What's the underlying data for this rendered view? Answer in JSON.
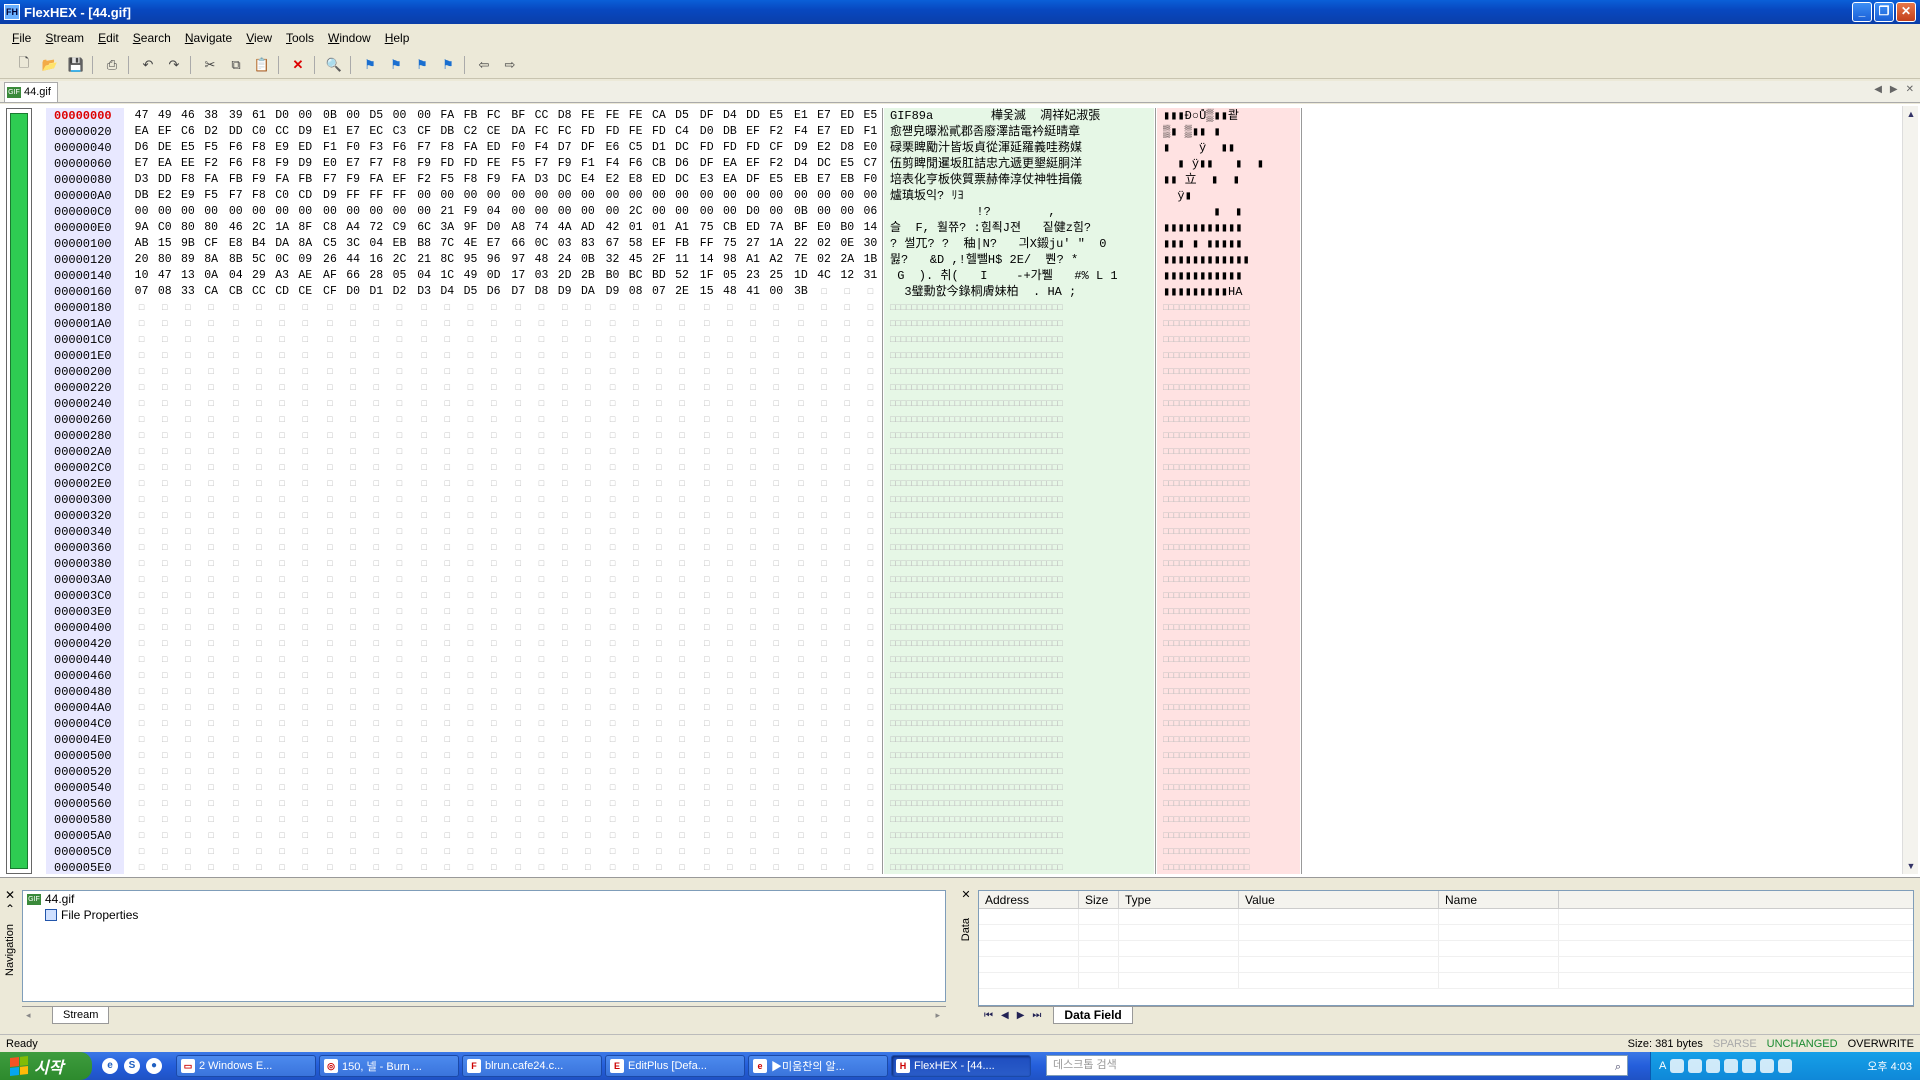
{
  "window": {
    "title": "FlexHEX - [44.gif]",
    "min": "_",
    "restore": "❐",
    "close": "✕"
  },
  "menu": [
    "File",
    "Stream",
    "Edit",
    "Search",
    "Navigate",
    "View",
    "Tools",
    "Window",
    "Help"
  ],
  "toolbar_icons": [
    "new-file-icon",
    "open-folder-icon",
    "save-icon",
    "print-icon",
    "undo-icon",
    "redo-icon",
    "cut-icon",
    "copy-icon",
    "paste-icon",
    "delete-icon",
    "find-icon",
    "bookmark-icon",
    "bookmark-prev-icon",
    "bookmark-next-icon",
    "bookmark-clear-icon",
    "back-icon",
    "forward-icon"
  ],
  "doc_tab": {
    "label": "44.gif",
    "close": "✕"
  },
  "offsets": [
    "00000000",
    "00000020",
    "00000040",
    "00000060",
    "00000080",
    "000000A0",
    "000000C0",
    "000000E0",
    "00000100",
    "00000120",
    "00000140",
    "00000160",
    "00000180",
    "000001A0",
    "000001C0",
    "000001E0",
    "00000200",
    "00000220",
    "00000240",
    "00000260",
    "00000280",
    "000002A0",
    "000002C0",
    "000002E0",
    "00000300",
    "00000320",
    "00000340",
    "00000360",
    "00000380",
    "000003A0",
    "000003C0",
    "000003E0",
    "00000400",
    "00000420",
    "00000440",
    "00000460",
    "00000480",
    "000004A0",
    "000004C0",
    "000004E0",
    "00000500",
    "00000520",
    "00000540",
    "00000560",
    "00000580",
    "000005A0",
    "000005C0",
    "000005E0"
  ],
  "hex_rows": [
    [
      "47",
      "49",
      "46",
      "38",
      "39",
      "61",
      "D0",
      "00",
      "0B",
      "00",
      "D5",
      "00",
      "00",
      "FA",
      "FB",
      "FC",
      "BF",
      "CC",
      "D8",
      "FE",
      "FE",
      "FE",
      "CA",
      "D5",
      "DF",
      "D4",
      "DD",
      "E5",
      "E1",
      "E7",
      "ED",
      "E5"
    ],
    [
      "EA",
      "EF",
      "C6",
      "D2",
      "DD",
      "C0",
      "CC",
      "D9",
      "E1",
      "E7",
      "EC",
      "C3",
      "CF",
      "DB",
      "C2",
      "CE",
      "DA",
      "FC",
      "FC",
      "FD",
      "FD",
      "FE",
      "FD",
      "C4",
      "D0",
      "DB",
      "EF",
      "F2",
      "F4",
      "E7",
      "ED",
      "F1"
    ],
    [
      "D6",
      "DE",
      "E5",
      "F5",
      "F6",
      "F8",
      "E9",
      "ED",
      "F1",
      "F0",
      "F3",
      "F6",
      "F7",
      "F8",
      "FA",
      "ED",
      "F0",
      "F4",
      "D7",
      "DF",
      "E6",
      "C5",
      "D1",
      "DC",
      "FD",
      "FD",
      "FD",
      "CF",
      "D9",
      "E2",
      "D8",
      "E0"
    ],
    [
      "E7",
      "EA",
      "EE",
      "F2",
      "F6",
      "F8",
      "F9",
      "D9",
      "E0",
      "E7",
      "F7",
      "F8",
      "F9",
      "FD",
      "FD",
      "FE",
      "F5",
      "F7",
      "F9",
      "F1",
      "F4",
      "F6",
      "CB",
      "D6",
      "DF",
      "EA",
      "EF",
      "F2",
      "D4",
      "DC",
      "E5",
      "C7"
    ],
    [
      "D3",
      "DD",
      "F8",
      "FA",
      "FB",
      "F9",
      "FA",
      "FB",
      "F7",
      "F9",
      "FA",
      "EF",
      "F2",
      "F5",
      "F8",
      "F9",
      "FA",
      "D3",
      "DC",
      "E4",
      "E2",
      "E8",
      "ED",
      "DC",
      "E3",
      "EA",
      "DF",
      "E5",
      "EB",
      "E7",
      "EB",
      "F0"
    ],
    [
      "DB",
      "E2",
      "E9",
      "F5",
      "F7",
      "F8",
      "C0",
      "CD",
      "D9",
      "FF",
      "FF",
      "FF",
      "00",
      "00",
      "00",
      "00",
      "00",
      "00",
      "00",
      "00",
      "00",
      "00",
      "00",
      "00",
      "00",
      "00",
      "00",
      "00",
      "00",
      "00",
      "00",
      "00"
    ],
    [
      "00",
      "00",
      "00",
      "00",
      "00",
      "00",
      "00",
      "00",
      "00",
      "00",
      "00",
      "00",
      "00",
      "21",
      "F9",
      "04",
      "00",
      "00",
      "00",
      "00",
      "00",
      "2C",
      "00",
      "00",
      "00",
      "00",
      "D0",
      "00",
      "0B",
      "00",
      "00",
      "06"
    ],
    [
      "9A",
      "C0",
      "80",
      "80",
      "46",
      "2C",
      "1A",
      "8F",
      "C8",
      "A4",
      "72",
      "C9",
      "6C",
      "3A",
      "9F",
      "D0",
      "A8",
      "74",
      "4A",
      "AD",
      "42",
      "01",
      "01",
      "A1",
      "75",
      "CB",
      "ED",
      "7A",
      "BF",
      "E0",
      "B0",
      "14"
    ],
    [
      "AB",
      "15",
      "9B",
      "CF",
      "E8",
      "B4",
      "DA",
      "8A",
      "C5",
      "3C",
      "04",
      "EB",
      "B8",
      "7C",
      "4E",
      "E7",
      "66",
      "0C",
      "03",
      "83",
      "67",
      "58",
      "EF",
      "FB",
      "FF",
      "75",
      "27",
      "1A",
      "22",
      "02",
      "0E",
      "30"
    ],
    [
      "20",
      "80",
      "89",
      "8A",
      "8B",
      "5C",
      "0C",
      "09",
      "26",
      "44",
      "16",
      "2C",
      "21",
      "8C",
      "95",
      "96",
      "97",
      "48",
      "24",
      "0B",
      "32",
      "45",
      "2F",
      "11",
      "14",
      "98",
      "A1",
      "A2",
      "7E",
      "02",
      "2A",
      "1B"
    ],
    [
      "10",
      "47",
      "13",
      "0A",
      "04",
      "29",
      "A3",
      "AE",
      "AF",
      "66",
      "28",
      "05",
      "04",
      "1C",
      "49",
      "0D",
      "17",
      "03",
      "2D",
      "2B",
      "B0",
      "BC",
      "BD",
      "52",
      "1F",
      "05",
      "23",
      "25",
      "1D",
      "4C",
      "12",
      "31"
    ],
    [
      "07",
      "08",
      "33",
      "CA",
      "CB",
      "CC",
      "CD",
      "CE",
      "CF",
      "D0",
      "D1",
      "D2",
      "D3",
      "D4",
      "D5",
      "D6",
      "D7",
      "D8",
      "D9",
      "DA",
      "D9",
      "08",
      "07",
      "2E",
      "15",
      "48",
      "41",
      "00",
      "3B",
      "",
      "",
      ""
    ]
  ],
  "ascii_rows": [
    "GIF89a        樺옻滅  凋祥妃淑張",
    "愈쨷皃曝淞貳郡좀廢澤詰電衿綎晴章",
    "碌栗睥勵汁皆坂貞從渾延羅義哇務媒",
    "伍剪睥閒暹坂肛詰忠亢遞更墾綎胴洋",
    "培表化亨板俠質票赫俸淳仗神牲揖儀",
    "爐瑱坂익? ﾘﾖ",
    "            !?        ,",
    "슬  F, 훨쮸? :힘죅J젼   짙健z힘?",
    "? 썰兀? ?  秞|N?   긔X鎩ju' \"  0",
    "뮗?   &D ,!헬뺄H$ 2E/  뿬? *",
    " G  ). 취(   I    -+가쀌   #% L 1",
    "  3璧勳핤今錄桐膚妹柏  . HA ;"
  ],
  "raw_rows": [
    "▮▮▮Ð○Ů▒▮▮쾉",
    "▒▮ ▒▮▮ ▮",
    "▮    ÿ  ▮▮",
    "  ▮ ÿ▮▮   ▮  ▮",
    "▮▮ 立  ▮  ▮",
    "  ÿ▮",
    "       ▮  ▮",
    "▮▮▮▮▮▮▮▮▮▮▮",
    "▮▮▮ ▮ ▮▮▮▮▮",
    "▮▮▮▮▮▮▮▮▮▮▮▮",
    "▮▮▮▮▮▮▮▮▮▮▮",
    "▮▮▮▮▮▮▮▮▮HA"
  ],
  "nav_pane": {
    "label": "Navigation",
    "close": "✕",
    "root": "44.gif",
    "child": "File Properties",
    "tab": "Stream"
  },
  "data_pane": {
    "label": "Data",
    "close": "✕",
    "columns": [
      "Address",
      "Size",
      "Type",
      "Value",
      "Name"
    ],
    "tab": "Data Field"
  },
  "status": {
    "left": "Ready",
    "size": "Size: 381 bytes",
    "sparse": "SPARSE",
    "unchanged": "UNCHANGED",
    "overwrite": "OVERWRITE"
  },
  "taskbar": {
    "start": "시작",
    "tasks": [
      "2 Windows E...",
      "150, 넬 - Burn ...",
      "blrun.cafe24.c...",
      "EditPlus [Defa...",
      "▶미움찬의 알...",
      "FlexHEX - [44...."
    ],
    "search_placeholder": "데스크톱 검색",
    "clock": "오후 4:03"
  },
  "colors": {
    "offset_bg": "#e8e8ff",
    "ascii_bg": "#e6f7e6",
    "raw_bg": "#ffe2e2",
    "position_bar": "#2ecc52",
    "title_bar": "#0a5fd8"
  }
}
